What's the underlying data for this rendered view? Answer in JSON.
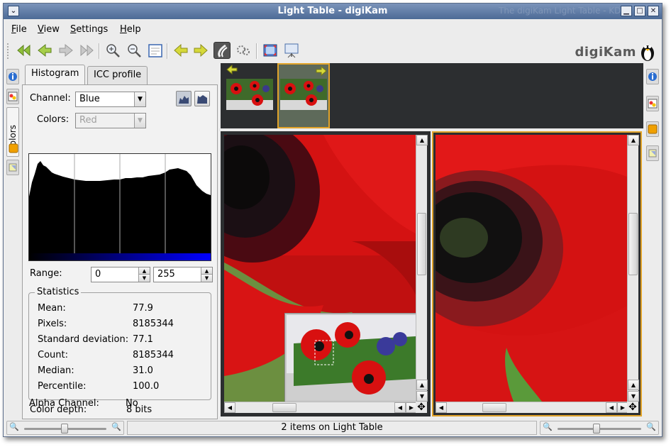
{
  "window": {
    "title": "Light Table - digiKam",
    "ghost_title": "The digiKam Light Table - KDE"
  },
  "menu": [
    {
      "key": "F",
      "rest": "ile"
    },
    {
      "key": "V",
      "rest": "iew"
    },
    {
      "key": "S",
      "rest": "ettings"
    },
    {
      "key": "H",
      "rest": "elp"
    }
  ],
  "toolbar": {
    "logo_text": "digiKam"
  },
  "left_sidebar": {
    "vertical_tab_label": "Colors",
    "tabs": [
      "Histogram",
      "ICC profile"
    ],
    "channel_label": "Channel:",
    "channel_value": "Blue",
    "colors_label": "Colors:",
    "colors_value": "Red",
    "range_label": "Range:",
    "range_min": "0",
    "range_max": "255",
    "statistics_title": "Statistics",
    "statistics": [
      {
        "label": "Mean:",
        "value": "77.9"
      },
      {
        "label": "Pixels:",
        "value": "8185344"
      },
      {
        "label": "Standard deviation:",
        "value": "77.1"
      },
      {
        "label": "Count:",
        "value": "8185344"
      },
      {
        "label": "Median:",
        "value": "31.0"
      },
      {
        "label": "Percentile:",
        "value": "100.0"
      }
    ],
    "color_depth_label": "Color depth:",
    "color_depth_value": "8 bits",
    "alpha_label": "Alpha Channel:",
    "alpha_value": "No"
  },
  "statusbar": {
    "message": "2 items on Light Table"
  },
  "colors": {
    "accent_selection": "#e2a42a",
    "titlebar": "#4c6a96",
    "thumbbar_bg": "#2c2e30",
    "histogram_bar": "#000000",
    "channel_gradient_end": "#0000ff"
  }
}
